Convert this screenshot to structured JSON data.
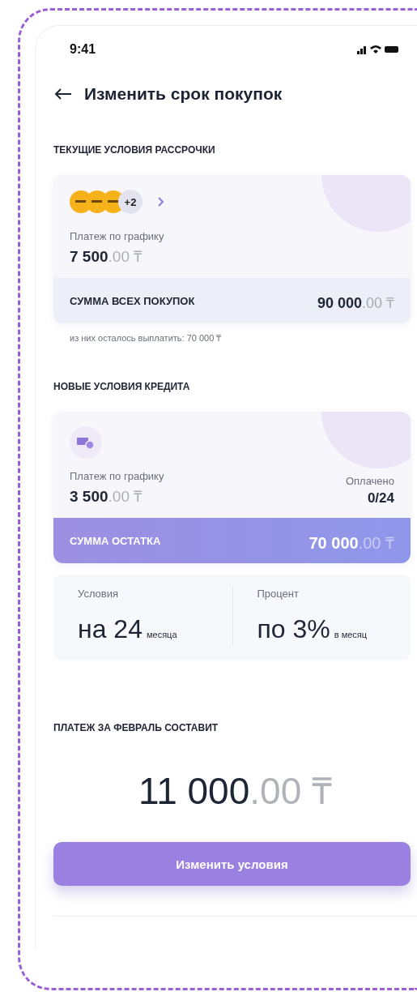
{
  "status_bar": {
    "time": "9:41"
  },
  "header": {
    "title": "Изменить срок покупок"
  },
  "current": {
    "section_title": "ТЕКУЩИЕ УСЛОВИЯ РАССРОЧКИ",
    "more_count": "+2",
    "payment_label": "Платеж по графику",
    "payment": {
      "whole": "7 500",
      "fraction": ".00",
      "currency": "₸"
    },
    "total_label": "СУММА ВСЕХ ПОКУПОК",
    "total": {
      "whole": "90 000",
      "fraction": ".00",
      "currency": "₸"
    },
    "note": "из них осталось выплатить: 70 000 ₸"
  },
  "new": {
    "section_title": "НОВЫЕ УСЛОВИЯ КРЕДИТА",
    "payment_label": "Платеж по графику",
    "payment": {
      "whole": "3 500",
      "fraction": ".00",
      "currency": "₸"
    },
    "paid_label": "Оплачено",
    "paid": "0/24",
    "rest_label": "СУММА ОСТАТКА",
    "rest": {
      "whole": "70 000",
      "fraction": ".00",
      "currency": "₸"
    }
  },
  "terms": [
    {
      "label": "Условия",
      "value": "на 24",
      "unit": "месяца"
    },
    {
      "label": "Процент",
      "value": "по 3%",
      "unit": "в месяц"
    }
  ],
  "february": {
    "label": "ПЛАТЕЖ ЗА ФЕВРАЛЬ СОСТАВИТ",
    "amount": {
      "whole": "11 000",
      "fraction": ".00",
      "currency": "₸"
    }
  },
  "button": "Изменить условия"
}
